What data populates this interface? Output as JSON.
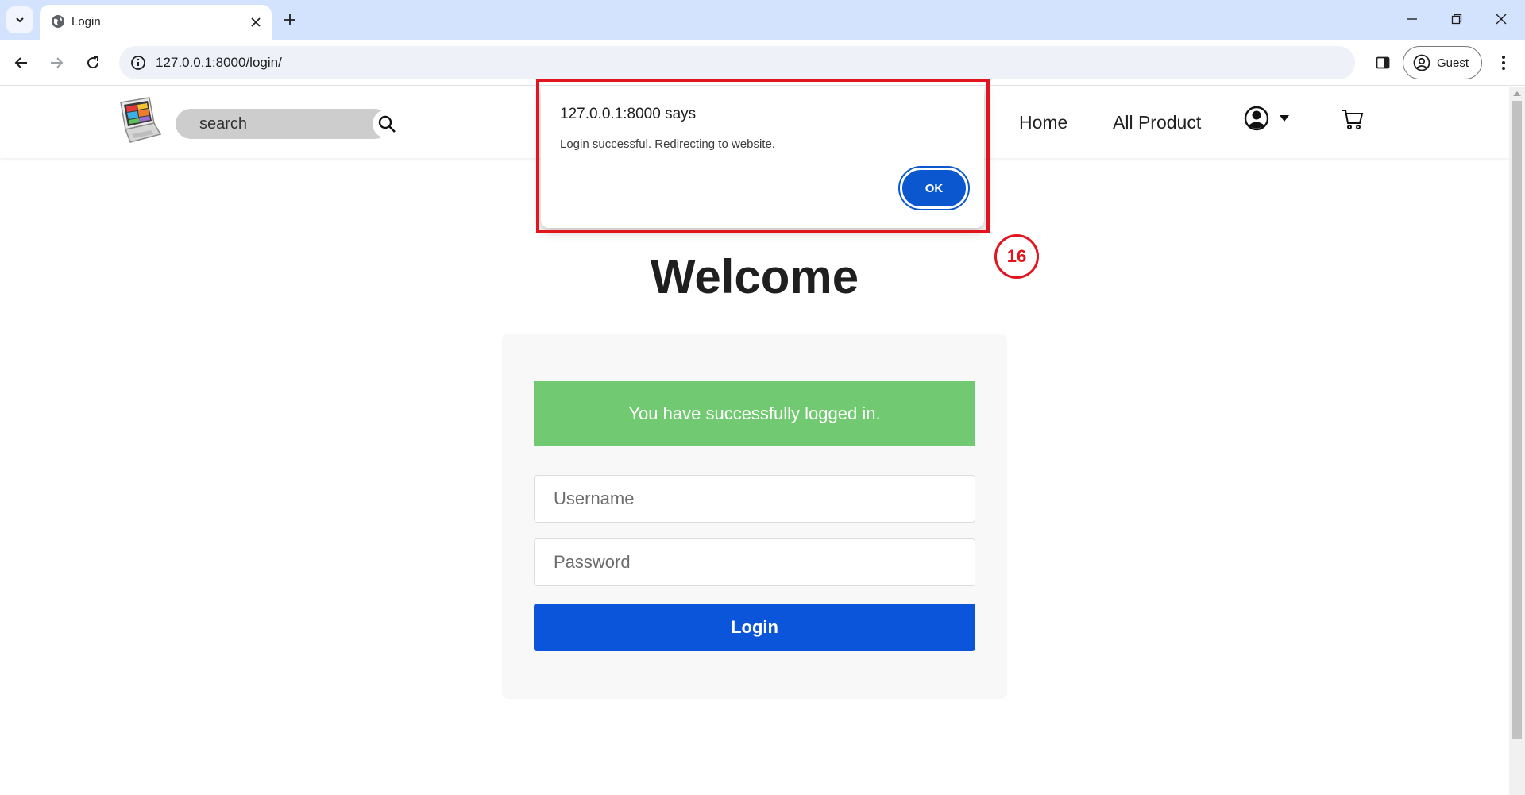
{
  "browser": {
    "tab_title": "Login",
    "url": "127.0.0.1:8000/login/",
    "profile_label": "Guest"
  },
  "site": {
    "search_placeholder": "search",
    "nav": {
      "home": "Home",
      "all_product": "All Product"
    }
  },
  "page": {
    "heading": "Welcome",
    "alert": "You have successfully logged in.",
    "username_placeholder": "Username",
    "password_placeholder": "Password",
    "login_label": "Login"
  },
  "dialog": {
    "title": "127.0.0.1:8000 says",
    "message": "Login successful. Redirecting to website.",
    "ok_label": "OK"
  },
  "annotation": {
    "badge": "16",
    "color": "#e3141e"
  },
  "colors": {
    "accent": "#0b55db",
    "success": "#71c971",
    "tabstrip": "#d3e3fd"
  }
}
